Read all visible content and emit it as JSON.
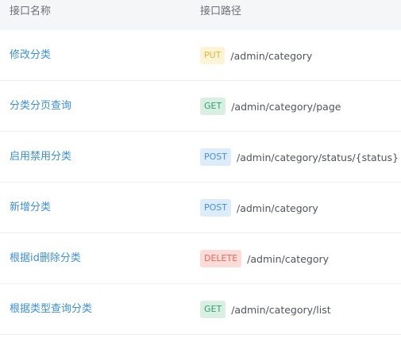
{
  "table": {
    "headers": {
      "name": "接口名称",
      "path": "接口路径"
    },
    "rows": [
      {
        "name": "修改分类",
        "method": "PUT",
        "method_class": "put",
        "path": "/admin/category"
      },
      {
        "name": "分类分页查询",
        "method": "GET",
        "method_class": "get",
        "path": "/admin/category/page"
      },
      {
        "name": "启用禁用分类",
        "method": "POST",
        "method_class": "post",
        "path": "/admin/category/status/{status}"
      },
      {
        "name": "新增分类",
        "method": "POST",
        "method_class": "post",
        "path": "/admin/category"
      },
      {
        "name": "根据id删除分类",
        "method": "DELETE",
        "method_class": "delete",
        "path": "/admin/category"
      },
      {
        "name": "根据类型查询分类",
        "method": "GET",
        "method_class": "get",
        "path": "/admin/category/list"
      }
    ]
  },
  "colors": {
    "link": "#3d8fd6",
    "header_bg": "#f5f6f8",
    "put_bg": "#fdf3d6",
    "put_fg": "#e2b53a",
    "get_bg": "#d9efe4",
    "get_fg": "#3a9d6a",
    "post_bg": "#dcecfa",
    "post_fg": "#4a90d9",
    "delete_bg": "#fbdcd8",
    "delete_fg": "#e4685d"
  }
}
